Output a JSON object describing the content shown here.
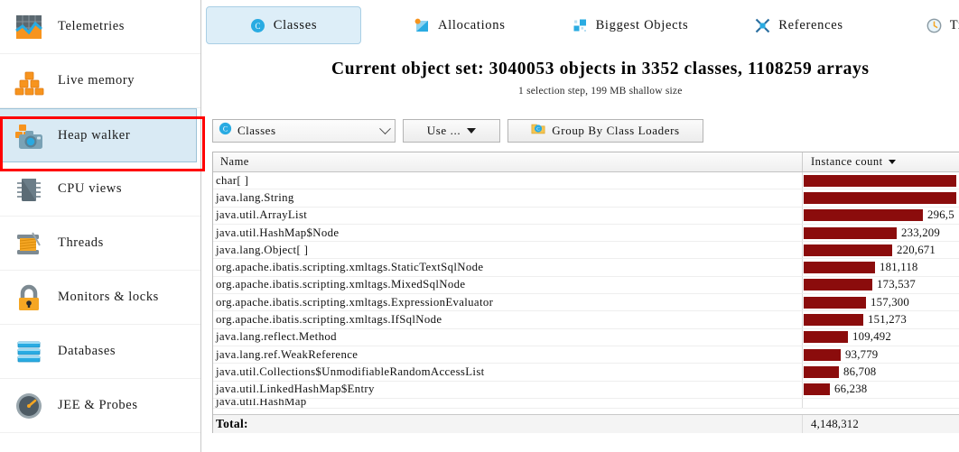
{
  "sidebar": {
    "items": [
      {
        "label": "Telemetries",
        "icon": "telemetries-icon",
        "selected": false
      },
      {
        "label": "Live memory",
        "icon": "live-memory-icon",
        "selected": false
      },
      {
        "label": "Heap walker",
        "icon": "heap-walker-icon",
        "selected": true
      },
      {
        "label": "CPU views",
        "icon": "cpu-views-icon",
        "selected": false
      },
      {
        "label": "Threads",
        "icon": "threads-icon",
        "selected": false
      },
      {
        "label": "Monitors & locks",
        "icon": "lock-icon",
        "selected": false
      },
      {
        "label": "Databases",
        "icon": "database-icon",
        "selected": false
      },
      {
        "label": "JEE & Probes",
        "icon": "gauge-icon",
        "selected": false
      }
    ]
  },
  "tabs": [
    {
      "label": "Classes",
      "icon": "classes-icon",
      "active": true
    },
    {
      "label": "Allocations",
      "icon": "allocations-icon",
      "active": false
    },
    {
      "label": "Biggest Objects",
      "icon": "biggest-objects-icon",
      "active": false
    },
    {
      "label": "References",
      "icon": "references-icon",
      "active": false
    },
    {
      "label": "Time",
      "icon": "clock-icon",
      "active": false
    }
  ],
  "header": {
    "headline": "Current object set: 3040053 objects in 3352 classes, 1108259 arrays",
    "subline": "1 selection step, 199 MB shallow size"
  },
  "toolbar": {
    "view_select": "Classes",
    "use_button": "Use ...",
    "group_button": "Group By Class Loaders"
  },
  "table": {
    "columns": [
      "Name",
      "Instance count"
    ],
    "sorted_column": "Instance count",
    "sort_direction": "desc",
    "bar_color": "#8b0c0c",
    "total_label": "Total:",
    "total_value": "4,148,312",
    "rows": [
      {
        "name": "char[ ]",
        "value": "",
        "bar_pct": 100
      },
      {
        "name": "java.lang.String",
        "value": "",
        "bar_pct": 100
      },
      {
        "name": "java.util.ArrayList",
        "value": "296,5",
        "bar_pct": 78
      },
      {
        "name": "java.util.HashMap$Node",
        "value": "233,209",
        "bar_pct": 61
      },
      {
        "name": "java.lang.Object[ ]",
        "value": "220,671",
        "bar_pct": 58
      },
      {
        "name": "org.apache.ibatis.scripting.xmltags.StaticTextSqlNode",
        "value": "181,118",
        "bar_pct": 47
      },
      {
        "name": "org.apache.ibatis.scripting.xmltags.MixedSqlNode",
        "value": "173,537",
        "bar_pct": 45
      },
      {
        "name": "org.apache.ibatis.scripting.xmltags.ExpressionEvaluator",
        "value": "157,300",
        "bar_pct": 41
      },
      {
        "name": "org.apache.ibatis.scripting.xmltags.IfSqlNode",
        "value": "151,273",
        "bar_pct": 39
      },
      {
        "name": "java.lang.reflect.Method",
        "value": "109,492",
        "bar_pct": 29
      },
      {
        "name": "java.lang.ref.WeakReference",
        "value": "93,779",
        "bar_pct": 24
      },
      {
        "name": "java.util.Collections$UnmodifiableRandomAccessList",
        "value": "86,708",
        "bar_pct": 23
      },
      {
        "name": "java.util.LinkedHashMap$Entry",
        "value": "66,238",
        "bar_pct": 17
      }
    ]
  },
  "annotation": {
    "type": "red-rectangle",
    "target": "Heap walker"
  }
}
